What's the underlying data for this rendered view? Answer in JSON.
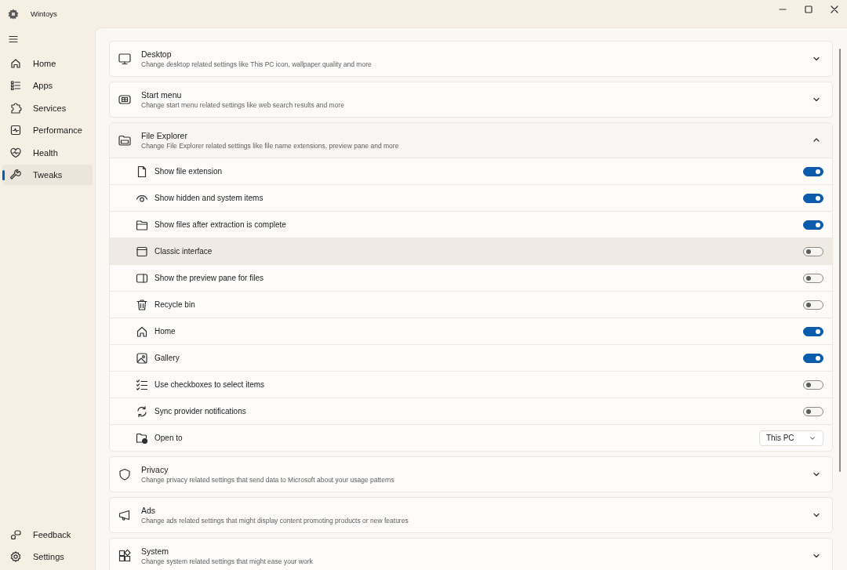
{
  "window": {
    "title": "Wintoys"
  },
  "sidebar": {
    "items": [
      {
        "label": "Home",
        "selected": false
      },
      {
        "label": "Apps",
        "selected": false
      },
      {
        "label": "Services",
        "selected": false
      },
      {
        "label": "Performance",
        "selected": false
      },
      {
        "label": "Health",
        "selected": false
      },
      {
        "label": "Tweaks",
        "selected": true
      }
    ],
    "footer_items": [
      {
        "label": "Feedback",
        "selected": false
      },
      {
        "label": "Settings",
        "selected": false
      }
    ]
  },
  "sections": [
    {
      "title": "Desktop",
      "description": "Change desktop related settings like This PC icon, wallpaper quality and more",
      "expanded": false
    },
    {
      "title": "Start menu",
      "description": "Change start menu related settings like web search results and more",
      "expanded": false
    },
    {
      "title": "File Explorer",
      "description": "Change File Explorer related settings like file name extensions, preview pane and more",
      "expanded": true,
      "rows": [
        {
          "kind": "toggle",
          "label": "Show file extension",
          "on": true,
          "hovered": false
        },
        {
          "kind": "toggle",
          "label": "Show hidden and system items",
          "on": true,
          "hovered": false
        },
        {
          "kind": "toggle",
          "label": "Show files after extraction is complete",
          "on": true,
          "hovered": false
        },
        {
          "kind": "toggle",
          "label": "Classic interface",
          "on": false,
          "hovered": true
        },
        {
          "kind": "toggle",
          "label": "Show the preview pane for files",
          "on": false,
          "hovered": false
        },
        {
          "kind": "toggle",
          "label": "Recycle bin",
          "on": false,
          "hovered": false
        },
        {
          "kind": "toggle",
          "label": "Home",
          "on": true,
          "hovered": false
        },
        {
          "kind": "toggle",
          "label": "Gallery",
          "on": true,
          "hovered": false
        },
        {
          "kind": "toggle",
          "label": "Use checkboxes to select items",
          "on": false,
          "hovered": false
        },
        {
          "kind": "toggle",
          "label": "Sync provider notifications",
          "on": false,
          "hovered": false
        },
        {
          "kind": "dropdown",
          "label": "Open to",
          "value": "This PC",
          "hovered": false
        }
      ]
    },
    {
      "title": "Privacy",
      "description": "Change privacy related settings that send data to Microsoft about your usage patterns",
      "expanded": false
    },
    {
      "title": "Ads",
      "description": "Change ads related settings that might display content promoting products or new features",
      "expanded": false
    },
    {
      "title": "System",
      "description": "Change system related settings that might ease your work",
      "expanded": false
    }
  ]
}
